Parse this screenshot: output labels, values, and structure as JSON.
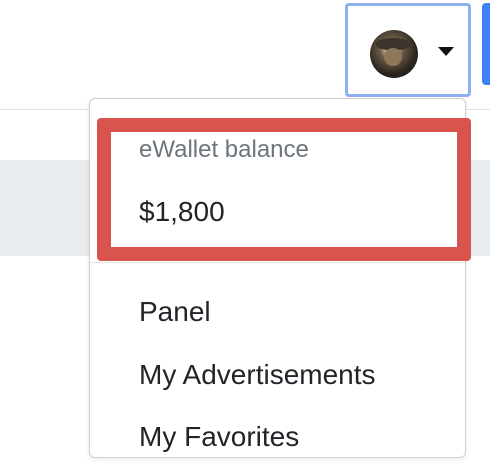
{
  "user_menu": {
    "avatar_icon": "user-avatar",
    "caret_icon": "caret-down-icon"
  },
  "wallet": {
    "label": "eWallet balance",
    "amount": "$1,800",
    "highlight_color": "#d9534f"
  },
  "menu": {
    "items": [
      {
        "label": "Panel"
      },
      {
        "label": "My Advertisements"
      },
      {
        "label": "My Favorites"
      }
    ]
  },
  "colors": {
    "focus_ring": "#8fb0ef",
    "accent": "#3b82f6"
  }
}
